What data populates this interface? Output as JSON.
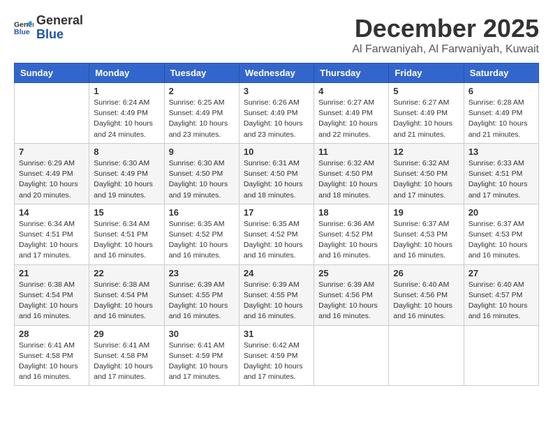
{
  "logo": {
    "line1": "General",
    "line2": "Blue"
  },
  "title": "December 2025",
  "subtitle": "Al Farwaniyah, Al Farwaniyah, Kuwait",
  "days_of_week": [
    "Sunday",
    "Monday",
    "Tuesday",
    "Wednesday",
    "Thursday",
    "Friday",
    "Saturday"
  ],
  "weeks": [
    [
      {
        "day": "",
        "info": ""
      },
      {
        "day": "1",
        "info": "Sunrise: 6:24 AM\nSunset: 4:49 PM\nDaylight: 10 hours\nand 24 minutes."
      },
      {
        "day": "2",
        "info": "Sunrise: 6:25 AM\nSunset: 4:49 PM\nDaylight: 10 hours\nand 23 minutes."
      },
      {
        "day": "3",
        "info": "Sunrise: 6:26 AM\nSunset: 4:49 PM\nDaylight: 10 hours\nand 23 minutes."
      },
      {
        "day": "4",
        "info": "Sunrise: 6:27 AM\nSunset: 4:49 PM\nDaylight: 10 hours\nand 22 minutes."
      },
      {
        "day": "5",
        "info": "Sunrise: 6:27 AM\nSunset: 4:49 PM\nDaylight: 10 hours\nand 21 minutes."
      },
      {
        "day": "6",
        "info": "Sunrise: 6:28 AM\nSunset: 4:49 PM\nDaylight: 10 hours\nand 21 minutes."
      }
    ],
    [
      {
        "day": "7",
        "info": "Sunrise: 6:29 AM\nSunset: 4:49 PM\nDaylight: 10 hours\nand 20 minutes."
      },
      {
        "day": "8",
        "info": "Sunrise: 6:30 AM\nSunset: 4:49 PM\nDaylight: 10 hours\nand 19 minutes."
      },
      {
        "day": "9",
        "info": "Sunrise: 6:30 AM\nSunset: 4:50 PM\nDaylight: 10 hours\nand 19 minutes."
      },
      {
        "day": "10",
        "info": "Sunrise: 6:31 AM\nSunset: 4:50 PM\nDaylight: 10 hours\nand 18 minutes."
      },
      {
        "day": "11",
        "info": "Sunrise: 6:32 AM\nSunset: 4:50 PM\nDaylight: 10 hours\nand 18 minutes."
      },
      {
        "day": "12",
        "info": "Sunrise: 6:32 AM\nSunset: 4:50 PM\nDaylight: 10 hours\nand 17 minutes."
      },
      {
        "day": "13",
        "info": "Sunrise: 6:33 AM\nSunset: 4:51 PM\nDaylight: 10 hours\nand 17 minutes."
      }
    ],
    [
      {
        "day": "14",
        "info": "Sunrise: 6:34 AM\nSunset: 4:51 PM\nDaylight: 10 hours\nand 17 minutes."
      },
      {
        "day": "15",
        "info": "Sunrise: 6:34 AM\nSunset: 4:51 PM\nDaylight: 10 hours\nand 16 minutes."
      },
      {
        "day": "16",
        "info": "Sunrise: 6:35 AM\nSunset: 4:52 PM\nDaylight: 10 hours\nand 16 minutes."
      },
      {
        "day": "17",
        "info": "Sunrise: 6:35 AM\nSunset: 4:52 PM\nDaylight: 10 hours\nand 16 minutes."
      },
      {
        "day": "18",
        "info": "Sunrise: 6:36 AM\nSunset: 4:52 PM\nDaylight: 10 hours\nand 16 minutes."
      },
      {
        "day": "19",
        "info": "Sunrise: 6:37 AM\nSunset: 4:53 PM\nDaylight: 10 hours\nand 16 minutes."
      },
      {
        "day": "20",
        "info": "Sunrise: 6:37 AM\nSunset: 4:53 PM\nDaylight: 10 hours\nand 16 minutes."
      }
    ],
    [
      {
        "day": "21",
        "info": "Sunrise: 6:38 AM\nSunset: 4:54 PM\nDaylight: 10 hours\nand 16 minutes."
      },
      {
        "day": "22",
        "info": "Sunrise: 6:38 AM\nSunset: 4:54 PM\nDaylight: 10 hours\nand 16 minutes."
      },
      {
        "day": "23",
        "info": "Sunrise: 6:39 AM\nSunset: 4:55 PM\nDaylight: 10 hours\nand 16 minutes."
      },
      {
        "day": "24",
        "info": "Sunrise: 6:39 AM\nSunset: 4:55 PM\nDaylight: 10 hours\nand 16 minutes."
      },
      {
        "day": "25",
        "info": "Sunrise: 6:39 AM\nSunset: 4:56 PM\nDaylight: 10 hours\nand 16 minutes."
      },
      {
        "day": "26",
        "info": "Sunrise: 6:40 AM\nSunset: 4:56 PM\nDaylight: 10 hours\nand 16 minutes."
      },
      {
        "day": "27",
        "info": "Sunrise: 6:40 AM\nSunset: 4:57 PM\nDaylight: 10 hours\nand 16 minutes."
      }
    ],
    [
      {
        "day": "28",
        "info": "Sunrise: 6:41 AM\nSunset: 4:58 PM\nDaylight: 10 hours\nand 16 minutes."
      },
      {
        "day": "29",
        "info": "Sunrise: 6:41 AM\nSunset: 4:58 PM\nDaylight: 10 hours\nand 17 minutes."
      },
      {
        "day": "30",
        "info": "Sunrise: 6:41 AM\nSunset: 4:59 PM\nDaylight: 10 hours\nand 17 minutes."
      },
      {
        "day": "31",
        "info": "Sunrise: 6:42 AM\nSunset: 4:59 PM\nDaylight: 10 hours\nand 17 minutes."
      },
      {
        "day": "",
        "info": ""
      },
      {
        "day": "",
        "info": ""
      },
      {
        "day": "",
        "info": ""
      }
    ]
  ]
}
